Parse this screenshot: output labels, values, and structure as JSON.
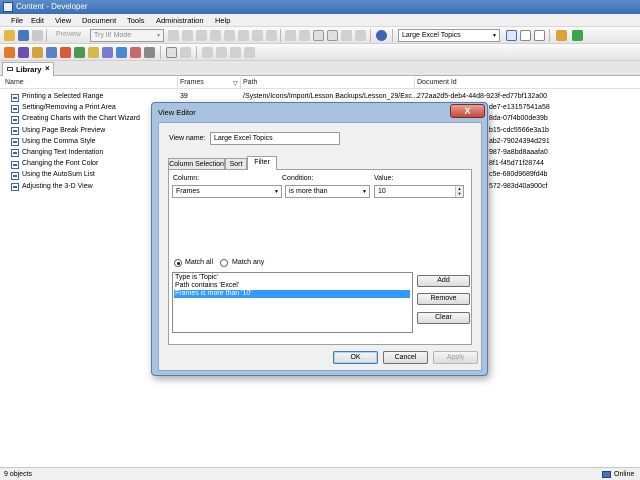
{
  "window": {
    "title": "Content - Developer"
  },
  "menu": [
    "File",
    "Edit",
    "View",
    "Document",
    "Tools",
    "Administration",
    "Help"
  ],
  "toolbar": {
    "preview_label": "Preview",
    "mode_value": "Try It! Mode",
    "view_value": "Large Excel Topics"
  },
  "library_tab": {
    "label": "Library",
    "close": "×"
  },
  "columns": {
    "name": "Name",
    "frames": "Frames",
    "path": "Path",
    "docid": "Document Id"
  },
  "rows": [
    {
      "name": "Printing a Selected Range",
      "frames": "39",
      "path": "/System/Icons/Import/Lesson Backups/Lesson_29/Exc...",
      "docid": "272aa2d5-deb4-44d8-923f-ed77bf132a00"
    },
    {
      "name": "Setting/Removing a Print Area",
      "frames": "",
      "path": "",
      "docid": "de7-e13157541a58"
    },
    {
      "name": "Creating Charts with the Chart Wizard",
      "frames": "",
      "path": "",
      "docid": "8da-07f4b00de39b"
    },
    {
      "name": "Using Page Break Preview",
      "frames": "",
      "path": "",
      "docid": "b15-cdc5566e3a1b"
    },
    {
      "name": "Using the Comma Style",
      "frames": "",
      "path": "",
      "docid": "ab2-79024394d291"
    },
    {
      "name": "Changing Text Indentation",
      "frames": "",
      "path": "",
      "docid": "987-9a8bd8aaafa0"
    },
    {
      "name": "Changing the Font Color",
      "frames": "",
      "path": "",
      "docid": "8f1-f45d71f28744"
    },
    {
      "name": "Using the AutoSum List",
      "frames": "",
      "path": "",
      "docid": "c5e-680d9689fd4b"
    },
    {
      "name": "Adjusting the 3-D View",
      "frames": "",
      "path": "",
      "docid": "572-983d40a900cf"
    }
  ],
  "status": {
    "left": "9 objects",
    "right": "Online"
  },
  "dialog": {
    "title": "View Editor",
    "close": "X",
    "view_name_label": "View name:",
    "view_name_value": "Large Excel Topics",
    "tabs": [
      "Column Selection",
      "Sort",
      "Filter"
    ],
    "column_label": "Column:",
    "column_value": "Frames",
    "condition_label": "Condition:",
    "condition_value": "is more than",
    "value_label": "Value:",
    "value_value": "10",
    "match_all": "Match all",
    "match_any": "Match any",
    "filters": [
      "Type is 'Topic'",
      "Path contains 'Excel'",
      "Frames is more than '10'"
    ],
    "buttons": {
      "add": "Add",
      "remove": "Remove",
      "clear": "Clear",
      "ok": "OK",
      "cancel": "Cancel",
      "apply": "Apply"
    }
  },
  "colors": {
    "titlebar": "#3a6db3",
    "selection": "#3399ff",
    "dialog_frame": "#a8c2e0"
  }
}
